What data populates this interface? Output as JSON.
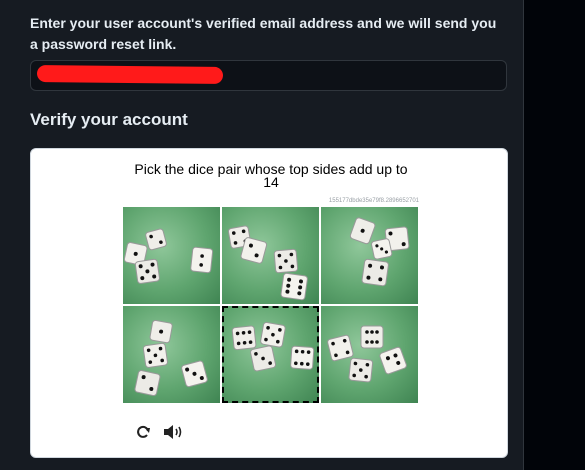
{
  "form": {
    "instruction": "Enter your user account's verified email address and we will send you a password reset link.",
    "email_value": "",
    "verify_heading": "Verify your account"
  },
  "captcha": {
    "prompt": "Pick the dice pair whose top sides add up to 14",
    "challenge_id": "155177dbde35e79f8.2896652701",
    "tiles": [
      {
        "label": "dice image 1",
        "selected": false
      },
      {
        "label": "dice image 2",
        "selected": false
      },
      {
        "label": "dice image 3",
        "selected": false
      },
      {
        "label": "dice image 4",
        "selected": false
      },
      {
        "label": "dice image 5",
        "selected": true
      },
      {
        "label": "dice image 6",
        "selected": false
      }
    ],
    "controls": {
      "refresh_icon": "refresh-icon",
      "audio_icon": "speaker-icon"
    }
  }
}
